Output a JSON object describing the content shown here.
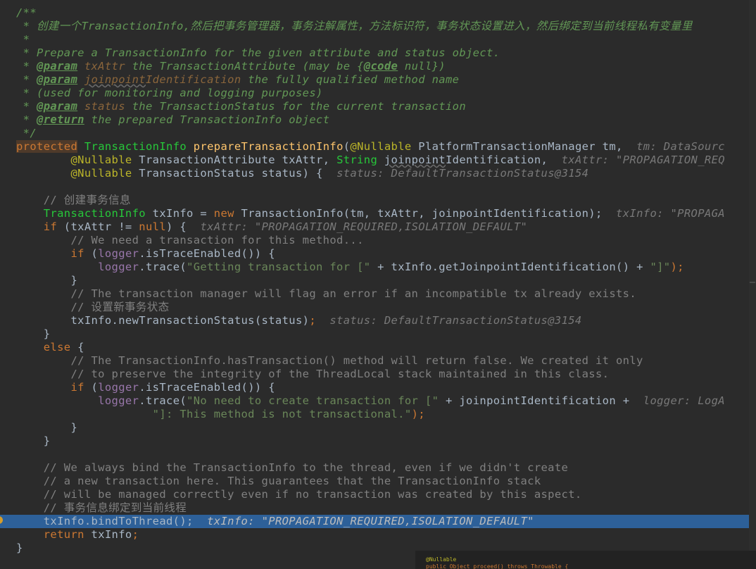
{
  "editor": {
    "lines": [
      [
        {
          "text": "/**",
          "cls": "c-doc"
        }
      ],
      [
        {
          "text": " * 创建一个TransactionInfo,然后把事务管理器，事务注解属性，方法标识符，事务状态设置进入，然后绑定到当前线程私有变量里",
          "cls": "c-doc"
        }
      ],
      [
        {
          "text": " *",
          "cls": "c-doc"
        }
      ],
      [
        {
          "text": " * Prepare a TransactionInfo for the given attribute and status object.",
          "cls": "c-doc"
        }
      ],
      [
        {
          "text": " * ",
          "cls": "c-doc"
        },
        {
          "text": "@param",
          "cls": "c-doctag"
        },
        {
          "text": " txAttr",
          "cls": "c-param"
        },
        {
          "text": " the TransactionAttribute (may be {",
          "cls": "c-doc"
        },
        {
          "text": "@code",
          "cls": "c-doctag"
        },
        {
          "text": " null})",
          "cls": "c-doc"
        }
      ],
      [
        {
          "text": " * ",
          "cls": "c-doc"
        },
        {
          "text": "@param",
          "cls": "c-doctag"
        },
        {
          "text": " ",
          "cls": "c-doc"
        },
        {
          "text": "joinpoint",
          "cls": "c-param c-squig"
        },
        {
          "text": "Identification",
          "cls": "c-param"
        },
        {
          "text": " the fully qualified method name",
          "cls": "c-doc"
        }
      ],
      [
        {
          "text": " * (used for monitoring and logging purposes)",
          "cls": "c-doc"
        }
      ],
      [
        {
          "text": " * ",
          "cls": "c-doc"
        },
        {
          "text": "@param",
          "cls": "c-doctag"
        },
        {
          "text": " status",
          "cls": "c-param"
        },
        {
          "text": " the TransactionStatus for the current transaction",
          "cls": "c-doc"
        }
      ],
      [
        {
          "text": " * ",
          "cls": "c-doc"
        },
        {
          "text": "@return",
          "cls": "c-doctag"
        },
        {
          "text": " the prepared TransactionInfo object",
          "cls": "c-doc"
        }
      ],
      [
        {
          "text": " */",
          "cls": "c-doc"
        }
      ],
      [
        {
          "text": "protected",
          "cls": "c-kwbg"
        },
        {
          "text": " ",
          "cls": "c-plain"
        },
        {
          "text": "TransactionInfo",
          "cls": "c-typegreen"
        },
        {
          "text": " ",
          "cls": "c-plain"
        },
        {
          "text": "prepareTransactionInfo",
          "cls": "c-method"
        },
        {
          "text": "(",
          "cls": "c-plain"
        },
        {
          "text": "@Nullable",
          "cls": "c-ann"
        },
        {
          "text": " PlatformTransactionManager tm,  ",
          "cls": "c-plain"
        },
        {
          "text": "tm: DataSourc",
          "cls": "c-hint"
        }
      ],
      [
        {
          "text": "        ",
          "cls": "c-plain"
        },
        {
          "text": "@Nullable",
          "cls": "c-ann"
        },
        {
          "text": " TransactionAttribute txAttr, ",
          "cls": "c-plain"
        },
        {
          "text": "String",
          "cls": "c-typegreen"
        },
        {
          "text": " ",
          "cls": "c-plain"
        },
        {
          "text": "joinpoint",
          "cls": "c-plain c-squig"
        },
        {
          "text": "Identification,  ",
          "cls": "c-plain"
        },
        {
          "text": "txAttr: \"PROPAGATION_REQ",
          "cls": "c-hint"
        }
      ],
      [
        {
          "text": "        ",
          "cls": "c-plain"
        },
        {
          "text": "@Nullable",
          "cls": "c-ann"
        },
        {
          "text": " TransactionStatus status) {  ",
          "cls": "c-plain"
        },
        {
          "text": "status: DefaultTransactionStatus@3154",
          "cls": "c-hint"
        }
      ],
      [
        {
          "text": "",
          "cls": "c-plain"
        }
      ],
      [
        {
          "text": "    // 创建事务信息",
          "cls": "c-comment"
        }
      ],
      [
        {
          "text": "    ",
          "cls": "c-plain"
        },
        {
          "text": "TransactionInfo",
          "cls": "c-typegreen"
        },
        {
          "text": " txInfo = ",
          "cls": "c-plain"
        },
        {
          "text": "new",
          "cls": "c-kw"
        },
        {
          "text": " TransactionInfo(tm, txAttr, joinpointIdentification);",
          "cls": "c-plain"
        },
        {
          "text": "  txInfo: \"PROPAGA",
          "cls": "c-hint"
        }
      ],
      [
        {
          "text": "    ",
          "cls": "c-plain"
        },
        {
          "text": "if",
          "cls": "c-kw"
        },
        {
          "text": " (txAttr != ",
          "cls": "c-plain"
        },
        {
          "text": "null",
          "cls": "c-kw"
        },
        {
          "text": ") {  ",
          "cls": "c-plain"
        },
        {
          "text": "txAttr: \"PROPAGATION_REQUIRED,ISOLATION_DEFAULT\"",
          "cls": "c-hint"
        }
      ],
      [
        {
          "text": "        // We need a transaction for this method...",
          "cls": "c-comment"
        }
      ],
      [
        {
          "text": "        ",
          "cls": "c-plain"
        },
        {
          "text": "if",
          "cls": "c-kw"
        },
        {
          "text": " (",
          "cls": "c-plain"
        },
        {
          "text": "logger",
          "cls": "c-field"
        },
        {
          "text": ".isTraceEnabled()) {",
          "cls": "c-plain"
        }
      ],
      [
        {
          "text": "            ",
          "cls": "c-plain"
        },
        {
          "text": "logger",
          "cls": "c-field"
        },
        {
          "text": ".trace(",
          "cls": "c-plain"
        },
        {
          "text": "\"Getting transaction for [\"",
          "cls": "c-str"
        },
        {
          "text": " + txInfo.getJoinpointIdentification() + ",
          "cls": "c-plain"
        },
        {
          "text": "\"]\"",
          "cls": "c-str"
        },
        {
          "text": ");",
          "cls": "c-kw"
        }
      ],
      [
        {
          "text": "        }",
          "cls": "c-plain"
        }
      ],
      [
        {
          "text": "        // The transaction manager will flag an error if an incompatible tx already exists.",
          "cls": "c-comment"
        }
      ],
      [
        {
          "text": "        // 设置新事务状态",
          "cls": "c-comment"
        }
      ],
      [
        {
          "text": "        txInfo.newTransactionStatus(status)",
          "cls": "c-plain"
        },
        {
          "text": ";",
          "cls": "c-kw"
        },
        {
          "text": "  ",
          "cls": "c-plain"
        },
        {
          "text": "status: DefaultTransactionStatus@3154",
          "cls": "c-hint"
        }
      ],
      [
        {
          "text": "    }",
          "cls": "c-plain"
        }
      ],
      [
        {
          "text": "    ",
          "cls": "c-plain"
        },
        {
          "text": "else",
          "cls": "c-kw"
        },
        {
          "text": " {",
          "cls": "c-plain"
        }
      ],
      [
        {
          "text": "        // The TransactionInfo.hasTransaction() method will return false. We created it only",
          "cls": "c-comment"
        }
      ],
      [
        {
          "text": "        // to preserve the integrity of the ThreadLocal stack maintained in this class.",
          "cls": "c-comment"
        }
      ],
      [
        {
          "text": "        ",
          "cls": "c-plain"
        },
        {
          "text": "if",
          "cls": "c-kw"
        },
        {
          "text": " (",
          "cls": "c-plain"
        },
        {
          "text": "logger",
          "cls": "c-field"
        },
        {
          "text": ".isTraceEnabled()) {",
          "cls": "c-plain"
        }
      ],
      [
        {
          "text": "            ",
          "cls": "c-plain"
        },
        {
          "text": "logger",
          "cls": "c-field"
        },
        {
          "text": ".trace(",
          "cls": "c-plain"
        },
        {
          "text": "\"No need to create transaction for [\"",
          "cls": "c-str"
        },
        {
          "text": " + joinpointIdentification +  ",
          "cls": "c-plain"
        },
        {
          "text": "logger: LogA",
          "cls": "c-hint"
        }
      ],
      [
        {
          "text": "                    ",
          "cls": "c-plain"
        },
        {
          "text": "\"]: This method is not transactional.\"",
          "cls": "c-str"
        },
        {
          "text": ");",
          "cls": "c-kw"
        }
      ],
      [
        {
          "text": "        }",
          "cls": "c-plain"
        }
      ],
      [
        {
          "text": "    }",
          "cls": "c-plain"
        }
      ],
      [
        {
          "text": "",
          "cls": "c-plain"
        }
      ],
      [
        {
          "text": "    // We always bind the TransactionInfo to the thread, even if we didn't create",
          "cls": "c-comment"
        }
      ],
      [
        {
          "text": "    // a new transaction here. This guarantees that the TransactionInfo stack",
          "cls": "c-comment"
        }
      ],
      [
        {
          "text": "    // will be managed correctly even if no transaction was created by this aspect.",
          "cls": "c-comment"
        }
      ],
      [
        {
          "text": "    // 事务信息绑定到当前线程",
          "cls": "c-comment"
        }
      ],
      [
        {
          "text": "    txInfo.bindToThread();",
          "cls": "c-plain"
        },
        {
          "text": "  ",
          "cls": "c-plain"
        },
        {
          "text": "txInfo: ",
          "cls": "c-hint-on"
        },
        {
          "text": "\"PROPAGATION_REQUIRED,ISOLATION_DEFAULT\"",
          "cls": "c-hint-on"
        }
      ],
      [
        {
          "text": "    ",
          "cls": "c-plain"
        },
        {
          "text": "return",
          "cls": "c-kw"
        },
        {
          "text": " txInfo",
          "cls": "c-plain"
        },
        {
          "text": ";",
          "cls": "c-kw"
        }
      ],
      [
        {
          "text": "}",
          "cls": "c-plain"
        }
      ]
    ],
    "current_line_index": 38
  },
  "overlay": {
    "lines": [
      {
        "text": "@Nullable",
        "cls": "c-ann"
      },
      {
        "text": "public Object proceed() throws Throwable {",
        "cls": "c-kw"
      }
    ]
  }
}
